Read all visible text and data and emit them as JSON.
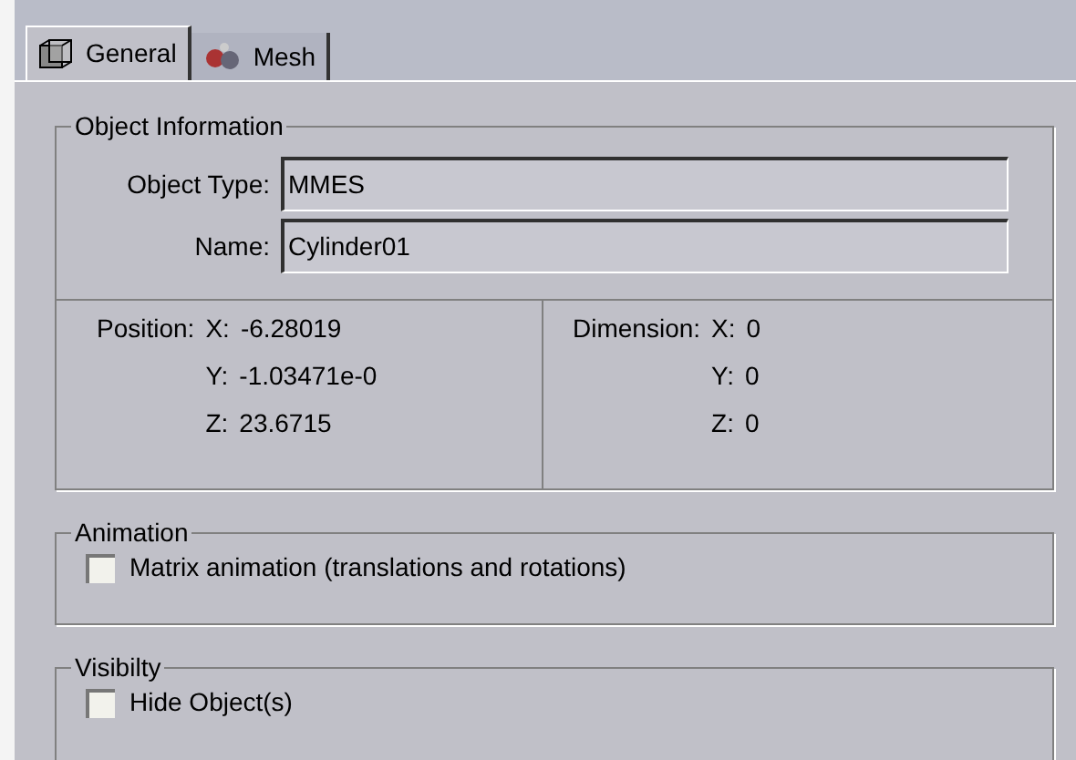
{
  "tabs": [
    {
      "label": "General",
      "kind": "general",
      "selected": true
    },
    {
      "label": "Mesh",
      "kind": "mesh",
      "selected": false
    }
  ],
  "object_information": {
    "title": "Object Information",
    "fields": [
      {
        "label": "Object Type:",
        "value": "MMES"
      },
      {
        "label": "Name:",
        "value": "Cylinder01"
      }
    ],
    "position": {
      "label": "Position:",
      "rows": [
        {
          "axis": "X:",
          "value": "-6.28019"
        },
        {
          "axis": "Y:",
          "value": "-1.03471e-0"
        },
        {
          "axis": "Z:",
          "value": "23.6715"
        }
      ]
    },
    "dimension": {
      "label": "Dimension:",
      "rows": [
        {
          "axis": "X:",
          "value": "0"
        },
        {
          "axis": "Y:",
          "value": "0"
        },
        {
          "axis": "Z:",
          "value": "0"
        }
      ]
    }
  },
  "groups": [
    {
      "title": "Animation",
      "checkbox": {
        "label": "Matrix animation (translations and rotations)",
        "checked": false
      }
    },
    {
      "title": "Visibilty",
      "checkbox": {
        "label": "Hide Object(s)",
        "checked": false
      }
    }
  ]
}
